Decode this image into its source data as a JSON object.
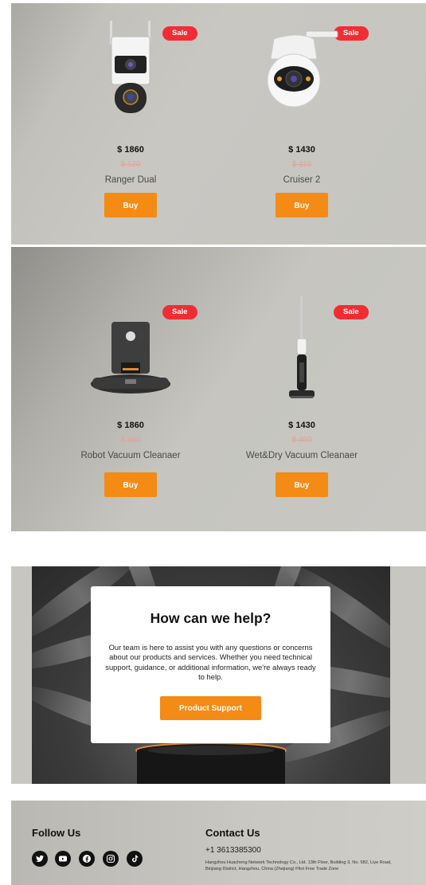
{
  "products": [
    {
      "badge": "Sale",
      "price": "$ 1860",
      "old_price": "$ 120",
      "name": "Ranger Dual",
      "button": "Buy",
      "image": "dual-lens-security-camera"
    },
    {
      "badge": "Sale",
      "price": "$ 1430",
      "old_price": "$ 110",
      "name": "Cruiser 2",
      "button": "Buy",
      "image": "dome-security-camera"
    },
    {
      "badge": "Sale",
      "price": "$ 1860",
      "old_price": "$ 450",
      "name": "Robot Vacuum Cleanaer",
      "button": "Buy",
      "image": "robot-vacuum-station"
    },
    {
      "badge": "Sale",
      "price": "$ 1430",
      "old_price": "$ 400",
      "name": "Wet&Dry Vacuum Cleanaer",
      "button": "Buy",
      "image": "stick-vacuum"
    }
  ],
  "help": {
    "title": "How can we help?",
    "body": "Our team is here to assist you with any questions or concerns about our products and services. Whether you need technical support, guidance, or additional information, we're always ready to help.",
    "button": "Product Support"
  },
  "footer": {
    "follow_title": "Follow Us",
    "social": [
      "twitter-icon",
      "youtube-icon",
      "facebook-icon",
      "instagram-icon",
      "tiktok-icon"
    ],
    "contact_title": "Contact Us",
    "phone": "+1 3613385300",
    "address": "Hangzhou Huacheng Network Technology Co., Ltd. 13th Floor, Building 3, No. 582, Liye Road, Binjiang District, Hangzhou, China (Zhejiang) Pilot Free Trade Zone"
  },
  "colors": {
    "accent": "#f38b14",
    "sale": "#f12d33"
  }
}
